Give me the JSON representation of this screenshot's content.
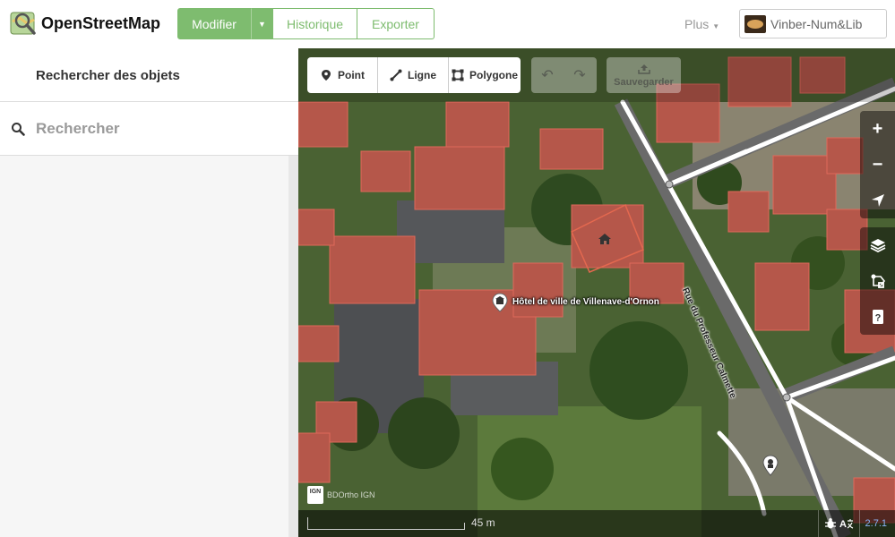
{
  "brand": {
    "name": "OpenStreetMap"
  },
  "nav": {
    "edit_label": "Modifier",
    "history_label": "Historique",
    "export_label": "Exporter",
    "more_label": "Plus",
    "user_name": "Vinber-Num&Lib"
  },
  "sidebar": {
    "title": "Rechercher des objets",
    "search_placeholder": "Rechercher"
  },
  "toolbar": {
    "point_label": "Point",
    "line_label": "Ligne",
    "polygon_label": "Polygone",
    "save_label": "Sauvegarder"
  },
  "map": {
    "poi_label": "Hôtel de ville de Villenave-d'Ornon",
    "street_label": "Rue du Professeur Calmette",
    "attribution": "BDOrtho IGN",
    "ign_badge": "IGN",
    "scale_label": "45 m",
    "version": "2.7.1"
  },
  "colors": {
    "brand_green": "#7ebc6f"
  }
}
